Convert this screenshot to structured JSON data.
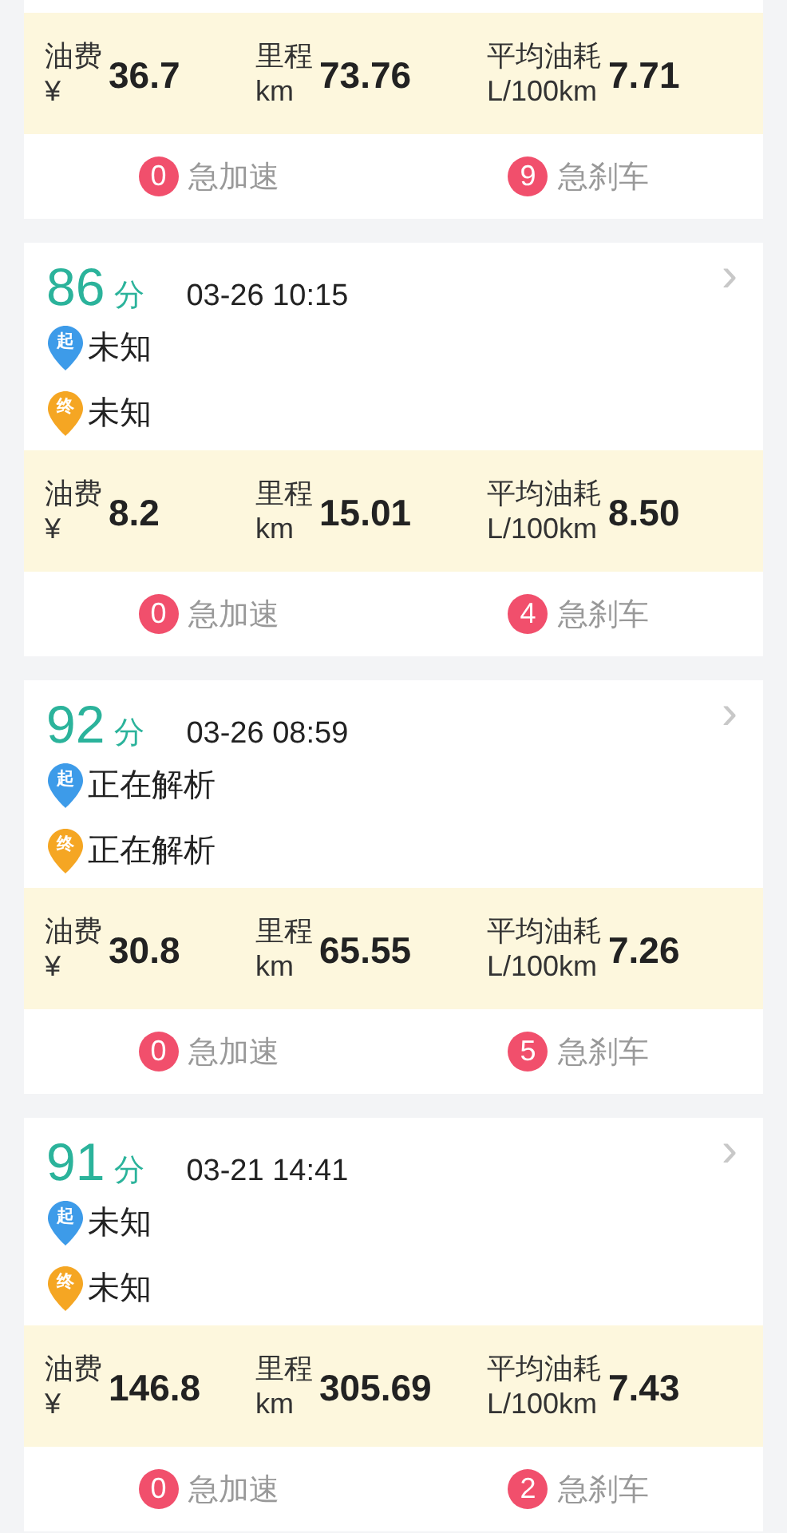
{
  "trips": [
    {
      "stats": [
        {
          "label": "油费",
          "unit": "¥",
          "value": "36.7"
        },
        {
          "label": "里程",
          "unit": "km",
          "value": "73.76"
        },
        {
          "label": "平均油耗",
          "unit": "L/100km",
          "value": "7.71"
        }
      ],
      "events": [
        {
          "count": "0",
          "label": "急加速"
        },
        {
          "count": "9",
          "label": "急刹车"
        }
      ]
    },
    {
      "score": "86",
      "score_unit": "分",
      "time": "03-26 10:15",
      "chevron": "›",
      "places": [
        {
          "pin": "起",
          "name": "未知",
          "color": "#3d9be9"
        },
        {
          "pin": "终",
          "name": "未知",
          "color": "#f5a623"
        }
      ],
      "stats": [
        {
          "label": "油费",
          "unit": "¥",
          "value": "8.2"
        },
        {
          "label": "里程",
          "unit": "km",
          "value": "15.01"
        },
        {
          "label": "平均油耗",
          "unit": "L/100km",
          "value": "8.50"
        }
      ],
      "events": [
        {
          "count": "0",
          "label": "急加速"
        },
        {
          "count": "4",
          "label": "急刹车"
        }
      ]
    },
    {
      "score": "92",
      "score_unit": "分",
      "time": "03-26 08:59",
      "chevron": "›",
      "places": [
        {
          "pin": "起",
          "name": "正在解析",
          "color": "#3d9be9"
        },
        {
          "pin": "终",
          "name": "正在解析",
          "color": "#f5a623"
        }
      ],
      "stats": [
        {
          "label": "油费",
          "unit": "¥",
          "value": "30.8"
        },
        {
          "label": "里程",
          "unit": "km",
          "value": "65.55"
        },
        {
          "label": "平均油耗",
          "unit": "L/100km",
          "value": "7.26"
        }
      ],
      "events": [
        {
          "count": "0",
          "label": "急加速"
        },
        {
          "count": "5",
          "label": "急刹车"
        }
      ]
    },
    {
      "score": "91",
      "score_unit": "分",
      "time": "03-21 14:41",
      "chevron": "›",
      "places": [
        {
          "pin": "起",
          "name": "未知",
          "color": "#3d9be9"
        },
        {
          "pin": "终",
          "name": "未知",
          "color": "#f5a623"
        }
      ],
      "stats": [
        {
          "label": "油费",
          "unit": "¥",
          "value": "146.8"
        },
        {
          "label": "里程",
          "unit": "km",
          "value": "305.69"
        },
        {
          "label": "平均油耗",
          "unit": "L/100km",
          "value": "7.43"
        }
      ],
      "events": [
        {
          "count": "0",
          "label": "急加速"
        },
        {
          "count": "2",
          "label": "急刹车"
        }
      ]
    }
  ]
}
